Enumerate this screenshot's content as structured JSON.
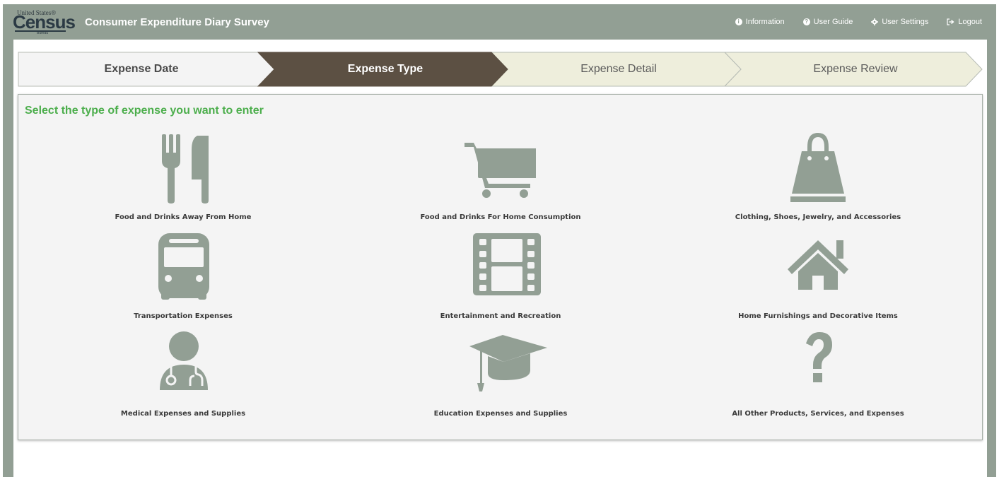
{
  "header": {
    "logo": {
      "top_text": "United States®",
      "main_text": "Census",
      "bottom_text": "Bureau"
    },
    "app_title": "Consumer Expenditure Diary Survey",
    "nav": [
      {
        "label": "Information",
        "icon": "info-circle-icon"
      },
      {
        "label": "User Guide",
        "icon": "question-circle-icon"
      },
      {
        "label": "User Settings",
        "icon": "gear-icon"
      },
      {
        "label": "Logout",
        "icon": "logout-icon"
      }
    ]
  },
  "steps": [
    {
      "label": "Expense Date",
      "state": "completed"
    },
    {
      "label": "Expense Type",
      "state": "active"
    },
    {
      "label": "Expense Detail",
      "state": "upcoming"
    },
    {
      "label": "Expense Review",
      "state": "upcoming"
    }
  ],
  "panel": {
    "title": "Select the type of expense you want to enter",
    "tiles": [
      {
        "label": "Food and Drinks Away From Home",
        "icon": "fork-knife-icon"
      },
      {
        "label": "Food and Drinks For Home Consumption",
        "icon": "shopping-cart-icon"
      },
      {
        "label": "Clothing, Shoes, Jewelry, and Accessories",
        "icon": "shopping-bag-icon"
      },
      {
        "label": "Transportation Expenses",
        "icon": "bus-icon"
      },
      {
        "label": "Entertainment and Recreation",
        "icon": "film-icon"
      },
      {
        "label": "Home Furnishings and Decorative Items",
        "icon": "home-icon"
      },
      {
        "label": "Medical Expenses and Supplies",
        "icon": "doctor-icon"
      },
      {
        "label": "Education Expenses and Supplies",
        "icon": "graduation-cap-icon"
      },
      {
        "label": "All Other Products, Services, and Expenses",
        "icon": "question-mark-icon"
      }
    ]
  },
  "colors": {
    "header_bg": "#929f94",
    "step_completed_bg": "#f4f4f4",
    "step_active_bg": "#5c5043",
    "step_upcoming_bg": "#eeeedc",
    "icon_color": "#929f94",
    "title_green": "#4cae4c"
  }
}
